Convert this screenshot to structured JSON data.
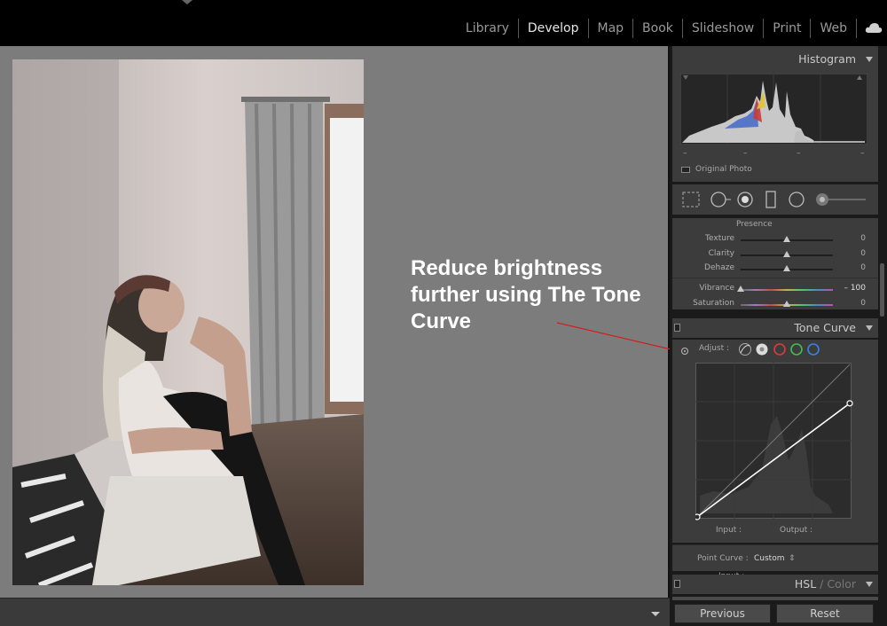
{
  "modules": [
    "Library",
    "Develop",
    "Map",
    "Book",
    "Slideshow",
    "Print",
    "Web"
  ],
  "active_module": "Develop",
  "annotation": "Reduce brightness further using The Tone Curve",
  "histogram": {
    "title": "Histogram",
    "original_photo_label": "Original Photo",
    "readouts": [
      "–",
      "–",
      "–",
      "–"
    ]
  },
  "tools": [
    "crop-overlay",
    "spot-removal",
    "red-eye",
    "graduated-filter",
    "radial-filter",
    "adjustment-brush"
  ],
  "presence": {
    "section_label": "Presence",
    "sliders": [
      {
        "label": "Texture",
        "value": "0",
        "level": 0.5
      },
      {
        "label": "Clarity",
        "value": "0",
        "level": 0.5
      },
      {
        "label": "Dehaze",
        "value": "0",
        "level": 0.5
      },
      {
        "label": "Vibrance",
        "value": "– 100",
        "level": 0.0
      },
      {
        "label": "Saturation",
        "value": "0",
        "level": 0.5
      }
    ]
  },
  "tone_curve": {
    "title": "Tone Curve",
    "adjust_label": "Adjust :",
    "input_label": "Input :",
    "output_label": "Output :",
    "point_curve_label": "Point Curve :",
    "point_curve_value": "Custom",
    "channel_colors": [
      "#ffffff",
      "#e03a3a",
      "#3cc24a",
      "#3b82e6"
    ],
    "curve_points": [
      [
        0,
        0
      ],
      [
        255,
        190
      ]
    ]
  },
  "hsl": {
    "title": "HSL",
    "separator": " / ",
    "color": "Color"
  },
  "buttons": {
    "previous": "Previous",
    "reset": "Reset"
  }
}
